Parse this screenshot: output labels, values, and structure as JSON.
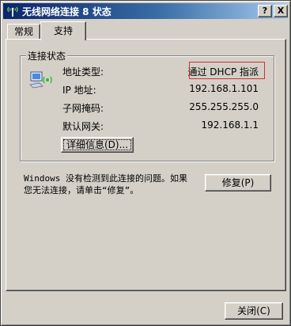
{
  "window": {
    "title": "无线网络连接 8 状态",
    "help_button": "?",
    "close_button": "X"
  },
  "tabs": [
    {
      "label": "常规",
      "active": false
    },
    {
      "label": "支持",
      "active": true
    }
  ],
  "connection_status": {
    "group_label": "连接状态",
    "icon": "wireless-network-icon",
    "rows": [
      {
        "label": "地址类型:",
        "value": "通过 DHCP 指派"
      },
      {
        "label": "IP 地址:",
        "value": "192.168.1.101"
      },
      {
        "label": "子网掩码:",
        "value": "255.255.255.0"
      },
      {
        "label": "默认网关:",
        "value": "192.168.1.1"
      }
    ],
    "details_button": "详细信息(D)..."
  },
  "repair": {
    "message_line1": "Windows 没有检测到此连接的问题。如果",
    "message_line2": "您无法连接，请单击“修复”。",
    "button": "修复(P)"
  },
  "footer": {
    "close_button": "关闭(C)"
  },
  "colors": {
    "title_gradient_start": "#0a246a",
    "title_gradient_end": "#a6caf0",
    "face": "#d4d0c8",
    "highlight_box": "#d03030"
  }
}
